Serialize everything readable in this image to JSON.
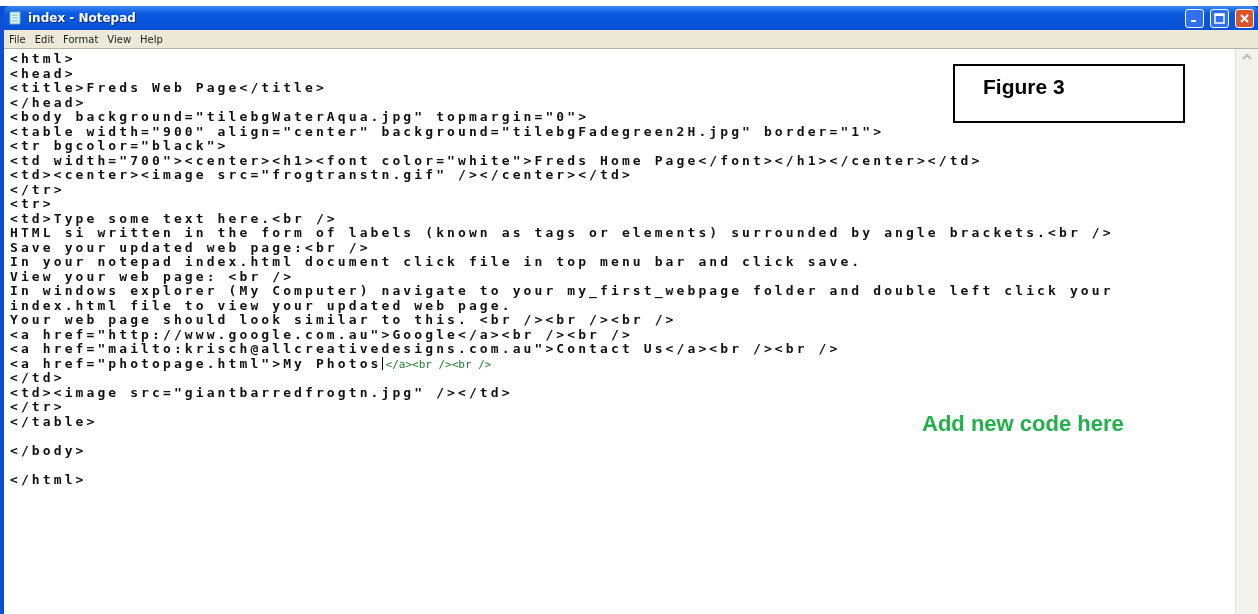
{
  "window": {
    "title": "index - Notepad"
  },
  "menu": [
    "File",
    "Edit",
    "Format",
    "View",
    "Help"
  ],
  "editor": {
    "blocks": [
      [
        {
          "text": "<html>"
        },
        {
          "text": "<head>"
        },
        {
          "text": "<title>Freds Web Page</title>"
        },
        {
          "text": "</head>"
        },
        {
          "text": "<body background=\"tilebgWaterAqua.jpg\" topmargin=\"0\">"
        },
        {
          "text": "<table width=\"900\" align=\"center\" background=\"tilebgFadegreen2H.jpg\" border=\"1\">"
        },
        {
          "text": "<tr bgcolor=\"black\">"
        },
        {
          "text": "<td width=\"700\"><center><h1><font color=\"white\">Freds Home Page</font></h1></center></td>"
        },
        {
          "text": "<td><center><image src=\"frogtranstn.gif\" /></center></td>"
        },
        {
          "text": "</tr>"
        },
        {
          "text": "<tr>"
        },
        {
          "text": "<td>Type some text here.<br />"
        },
        {
          "text": "HTML si written in the form of labels (known as tags or elements) surrounded by angle brackets.<br />"
        },
        {
          "text": "Save your updated web page:<br />"
        },
        {
          "text": "In your notepad index.html document click file in top menu bar and click save."
        },
        {
          "text": "View your web page: <br />"
        },
        {
          "text": "In windows explorer (My Computer) navigate to your my_first_webpage folder and double left click your"
        },
        {
          "text": "index.html file to view your updated web page."
        },
        {
          "text": "Your web page should look similar to this. <br /><br /><br />"
        },
        {
          "text": "<a href=\"http://www.google.com.au\">Google</a><br /><br />"
        },
        {
          "text": "<a href=\"mailto:krisch@allcreativedesigns.com.au\">Contact Us</a><br /><br />"
        },
        {
          "text": "<a href=\"photopage.html\">My Photos",
          "caret": true,
          "added": "</a><br /><br />"
        },
        {
          "text": "</td>"
        },
        {
          "text": "<td><image src=\"giantbarredfrogtn.jpg\" /></td>"
        },
        {
          "text": "</tr>"
        },
        {
          "text": "</table>"
        }
      ],
      [
        {
          "text": "</body>"
        }
      ],
      [
        {
          "text": "</html>"
        }
      ]
    ]
  },
  "callouts": [
    {
      "kind": "figure",
      "text": "Figure 3"
    },
    {
      "kind": "note",
      "text": "Add new code here"
    }
  ]
}
